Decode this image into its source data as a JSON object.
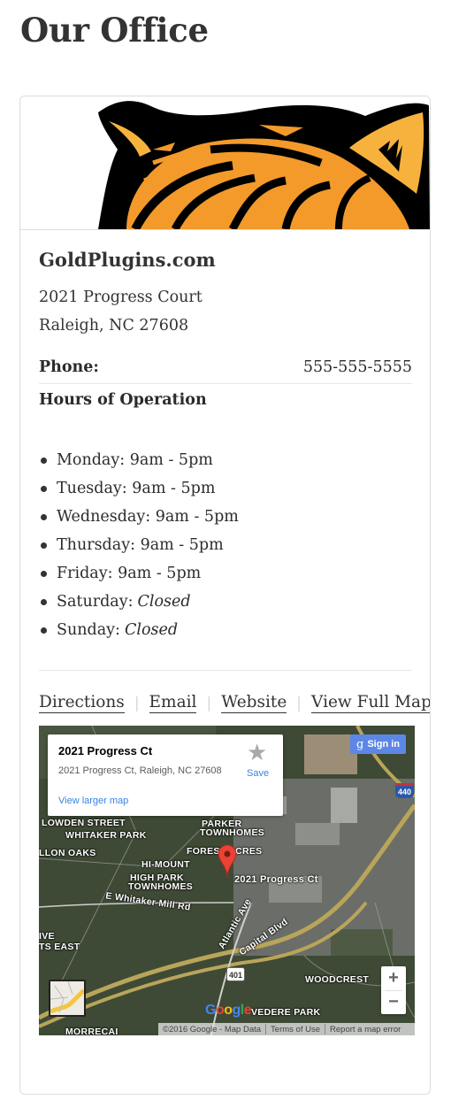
{
  "page": {
    "title": "Our Office"
  },
  "business": {
    "name": "GoldPlugins.com",
    "address_line1": "2021 Progress Court",
    "address_line2": "Raleigh, NC 27608",
    "phone_label": "Phone:",
    "phone": "555-555-5555",
    "logo_icon": "tiger-logo-icon"
  },
  "hours": {
    "title": "Hours of Operation",
    "items": [
      {
        "day": "Monday:",
        "time": "9am - 5pm",
        "closed": false
      },
      {
        "day": "Tuesday:",
        "time": "9am - 5pm",
        "closed": false
      },
      {
        "day": "Wednesday:",
        "time": "9am - 5pm",
        "closed": false
      },
      {
        "day": "Thursday:",
        "time": "9am - 5pm",
        "closed": false
      },
      {
        "day": "Friday:",
        "time": "9am - 5pm",
        "closed": false
      },
      {
        "day": "Saturday:",
        "time": "Closed",
        "closed": true
      },
      {
        "day": "Sunday:",
        "time": "Closed",
        "closed": true
      }
    ]
  },
  "links": {
    "directions": "Directions",
    "email": "Email",
    "website": "Website",
    "full_map": "View Full Map",
    "separator": "|"
  },
  "map": {
    "info_title": "2021 Progress Ct",
    "info_address": "2021 Progress Ct, Raleigh, NC 27608",
    "view_larger": "View larger map",
    "save_label": "Save",
    "signin_label": "Sign in",
    "signin_glyph": "g",
    "pin_label": "2021 Progress Ct",
    "labels": {
      "whitaker_park": "WHITAKER PARK",
      "llon_oaks": "LLON OAKS",
      "parker": "PARKER",
      "townhomes": "TOWNHOMES",
      "forest_acres": "FOREST ACRES",
      "hi_mount": "HI-MOUNT",
      "high_park": "HIGH PARK",
      "high_park_townhomes": "TOWNHOMES",
      "lowden": "LOWDEN STREET",
      "whitaker_mill": "E Whitaker Mill Rd",
      "atlantic": "Atlantic Ave",
      "capital": "Capital Blvd",
      "woodcrest": "WOODCREST",
      "belvedere": "VEDERE PARK",
      "its_east": "TS EAST",
      "ive": "IVE",
      "morrecai": "MORRECAI"
    },
    "shield_440": "440",
    "shield_401": "401",
    "zoom_in": "+",
    "zoom_out": "−",
    "google": [
      "G",
      "o",
      "o",
      "g",
      "l",
      "e"
    ],
    "google_colors": [
      "#4285f4",
      "#ea4335",
      "#fbbc05",
      "#4285f4",
      "#34a853",
      "#ea4335"
    ],
    "attribution": "©2016 Google - Map Data",
    "terms": "Terms of Use",
    "report": "Report a map error"
  },
  "colors": {
    "text": "#333333",
    "link_blue": "#3a84df",
    "signin_blue": "#5c87e6",
    "tiger_orange": "#f39a2a",
    "tiger_light": "#f7b23e"
  }
}
